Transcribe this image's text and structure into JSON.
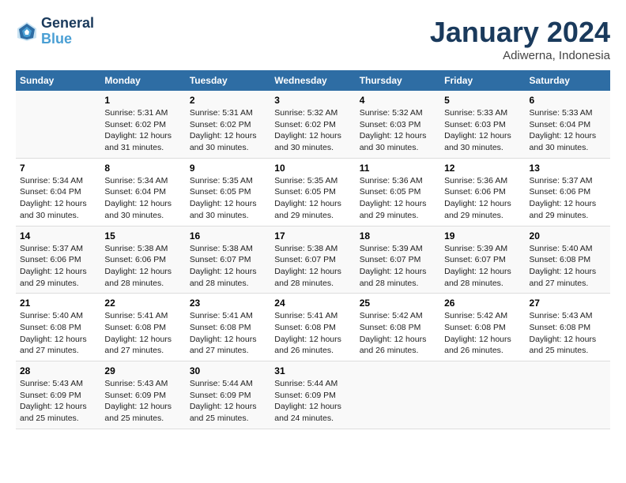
{
  "header": {
    "logo_line1": "General",
    "logo_line2": "Blue",
    "month_title": "January 2024",
    "subtitle": "Adiwerna, Indonesia"
  },
  "weekdays": [
    "Sunday",
    "Monday",
    "Tuesday",
    "Wednesday",
    "Thursday",
    "Friday",
    "Saturday"
  ],
  "weeks": [
    [
      {
        "day": "",
        "sunrise": "",
        "sunset": "",
        "daylight": ""
      },
      {
        "day": "1",
        "sunrise": "Sunrise: 5:31 AM",
        "sunset": "Sunset: 6:02 PM",
        "daylight": "Daylight: 12 hours and 31 minutes."
      },
      {
        "day": "2",
        "sunrise": "Sunrise: 5:31 AM",
        "sunset": "Sunset: 6:02 PM",
        "daylight": "Daylight: 12 hours and 30 minutes."
      },
      {
        "day": "3",
        "sunrise": "Sunrise: 5:32 AM",
        "sunset": "Sunset: 6:02 PM",
        "daylight": "Daylight: 12 hours and 30 minutes."
      },
      {
        "day": "4",
        "sunrise": "Sunrise: 5:32 AM",
        "sunset": "Sunset: 6:03 PM",
        "daylight": "Daylight: 12 hours and 30 minutes."
      },
      {
        "day": "5",
        "sunrise": "Sunrise: 5:33 AM",
        "sunset": "Sunset: 6:03 PM",
        "daylight": "Daylight: 12 hours and 30 minutes."
      },
      {
        "day": "6",
        "sunrise": "Sunrise: 5:33 AM",
        "sunset": "Sunset: 6:04 PM",
        "daylight": "Daylight: 12 hours and 30 minutes."
      }
    ],
    [
      {
        "day": "7",
        "sunrise": "Sunrise: 5:34 AM",
        "sunset": "Sunset: 6:04 PM",
        "daylight": "Daylight: 12 hours and 30 minutes."
      },
      {
        "day": "8",
        "sunrise": "Sunrise: 5:34 AM",
        "sunset": "Sunset: 6:04 PM",
        "daylight": "Daylight: 12 hours and 30 minutes."
      },
      {
        "day": "9",
        "sunrise": "Sunrise: 5:35 AM",
        "sunset": "Sunset: 6:05 PM",
        "daylight": "Daylight: 12 hours and 30 minutes."
      },
      {
        "day": "10",
        "sunrise": "Sunrise: 5:35 AM",
        "sunset": "Sunset: 6:05 PM",
        "daylight": "Daylight: 12 hours and 29 minutes."
      },
      {
        "day": "11",
        "sunrise": "Sunrise: 5:36 AM",
        "sunset": "Sunset: 6:05 PM",
        "daylight": "Daylight: 12 hours and 29 minutes."
      },
      {
        "day": "12",
        "sunrise": "Sunrise: 5:36 AM",
        "sunset": "Sunset: 6:06 PM",
        "daylight": "Daylight: 12 hours and 29 minutes."
      },
      {
        "day": "13",
        "sunrise": "Sunrise: 5:37 AM",
        "sunset": "Sunset: 6:06 PM",
        "daylight": "Daylight: 12 hours and 29 minutes."
      }
    ],
    [
      {
        "day": "14",
        "sunrise": "Sunrise: 5:37 AM",
        "sunset": "Sunset: 6:06 PM",
        "daylight": "Daylight: 12 hours and 29 minutes."
      },
      {
        "day": "15",
        "sunrise": "Sunrise: 5:38 AM",
        "sunset": "Sunset: 6:06 PM",
        "daylight": "Daylight: 12 hours and 28 minutes."
      },
      {
        "day": "16",
        "sunrise": "Sunrise: 5:38 AM",
        "sunset": "Sunset: 6:07 PM",
        "daylight": "Daylight: 12 hours and 28 minutes."
      },
      {
        "day": "17",
        "sunrise": "Sunrise: 5:38 AM",
        "sunset": "Sunset: 6:07 PM",
        "daylight": "Daylight: 12 hours and 28 minutes."
      },
      {
        "day": "18",
        "sunrise": "Sunrise: 5:39 AM",
        "sunset": "Sunset: 6:07 PM",
        "daylight": "Daylight: 12 hours and 28 minutes."
      },
      {
        "day": "19",
        "sunrise": "Sunrise: 5:39 AM",
        "sunset": "Sunset: 6:07 PM",
        "daylight": "Daylight: 12 hours and 28 minutes."
      },
      {
        "day": "20",
        "sunrise": "Sunrise: 5:40 AM",
        "sunset": "Sunset: 6:08 PM",
        "daylight": "Daylight: 12 hours and 27 minutes."
      }
    ],
    [
      {
        "day": "21",
        "sunrise": "Sunrise: 5:40 AM",
        "sunset": "Sunset: 6:08 PM",
        "daylight": "Daylight: 12 hours and 27 minutes."
      },
      {
        "day": "22",
        "sunrise": "Sunrise: 5:41 AM",
        "sunset": "Sunset: 6:08 PM",
        "daylight": "Daylight: 12 hours and 27 minutes."
      },
      {
        "day": "23",
        "sunrise": "Sunrise: 5:41 AM",
        "sunset": "Sunset: 6:08 PM",
        "daylight": "Daylight: 12 hours and 27 minutes."
      },
      {
        "day": "24",
        "sunrise": "Sunrise: 5:41 AM",
        "sunset": "Sunset: 6:08 PM",
        "daylight": "Daylight: 12 hours and 26 minutes."
      },
      {
        "day": "25",
        "sunrise": "Sunrise: 5:42 AM",
        "sunset": "Sunset: 6:08 PM",
        "daylight": "Daylight: 12 hours and 26 minutes."
      },
      {
        "day": "26",
        "sunrise": "Sunrise: 5:42 AM",
        "sunset": "Sunset: 6:08 PM",
        "daylight": "Daylight: 12 hours and 26 minutes."
      },
      {
        "day": "27",
        "sunrise": "Sunrise: 5:43 AM",
        "sunset": "Sunset: 6:08 PM",
        "daylight": "Daylight: 12 hours and 25 minutes."
      }
    ],
    [
      {
        "day": "28",
        "sunrise": "Sunrise: 5:43 AM",
        "sunset": "Sunset: 6:09 PM",
        "daylight": "Daylight: 12 hours and 25 minutes."
      },
      {
        "day": "29",
        "sunrise": "Sunrise: 5:43 AM",
        "sunset": "Sunset: 6:09 PM",
        "daylight": "Daylight: 12 hours and 25 minutes."
      },
      {
        "day": "30",
        "sunrise": "Sunrise: 5:44 AM",
        "sunset": "Sunset: 6:09 PM",
        "daylight": "Daylight: 12 hours and 25 minutes."
      },
      {
        "day": "31",
        "sunrise": "Sunrise: 5:44 AM",
        "sunset": "Sunset: 6:09 PM",
        "daylight": "Daylight: 12 hours and 24 minutes."
      },
      {
        "day": "",
        "sunrise": "",
        "sunset": "",
        "daylight": ""
      },
      {
        "day": "",
        "sunrise": "",
        "sunset": "",
        "daylight": ""
      },
      {
        "day": "",
        "sunrise": "",
        "sunset": "",
        "daylight": ""
      }
    ]
  ]
}
